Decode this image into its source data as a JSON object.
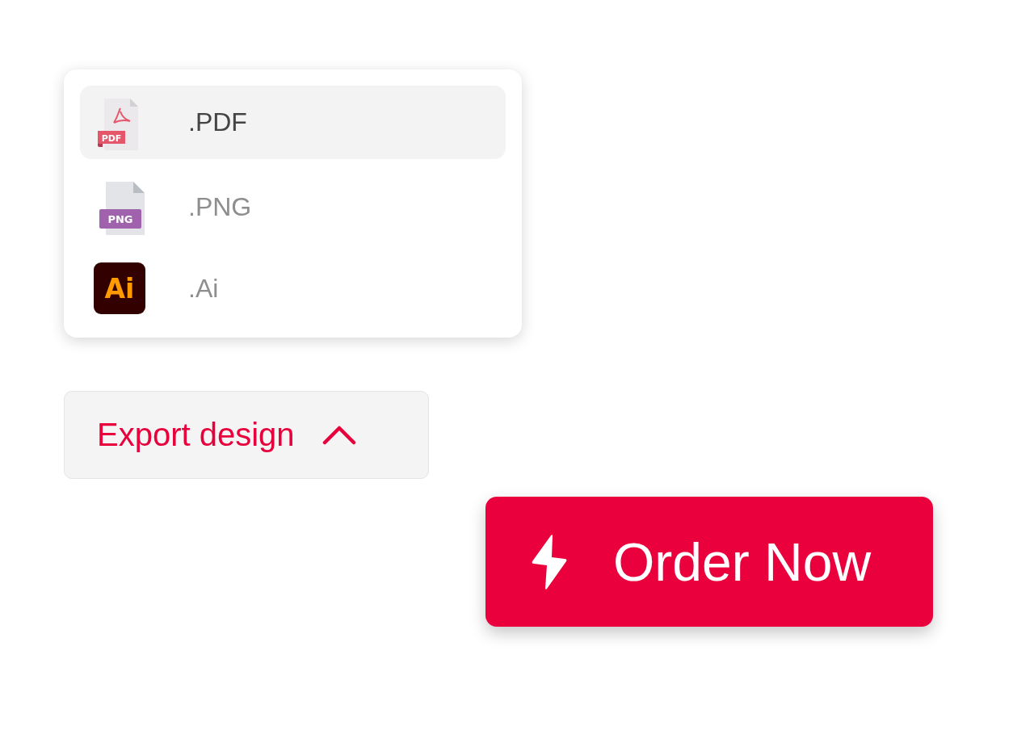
{
  "export_menu": {
    "items": [
      {
        "kind": "pdf",
        "badge": "PDF",
        "label": ".PDF",
        "selected": true
      },
      {
        "kind": "png",
        "badge": "PNG",
        "label": ".PNG",
        "selected": false
      },
      {
        "kind": "ai",
        "badge": "Ai",
        "label": ".Ai",
        "selected": false
      }
    ]
  },
  "export_button": {
    "label": "Export design",
    "expanded": true
  },
  "order_button": {
    "label": "Order Now"
  }
}
